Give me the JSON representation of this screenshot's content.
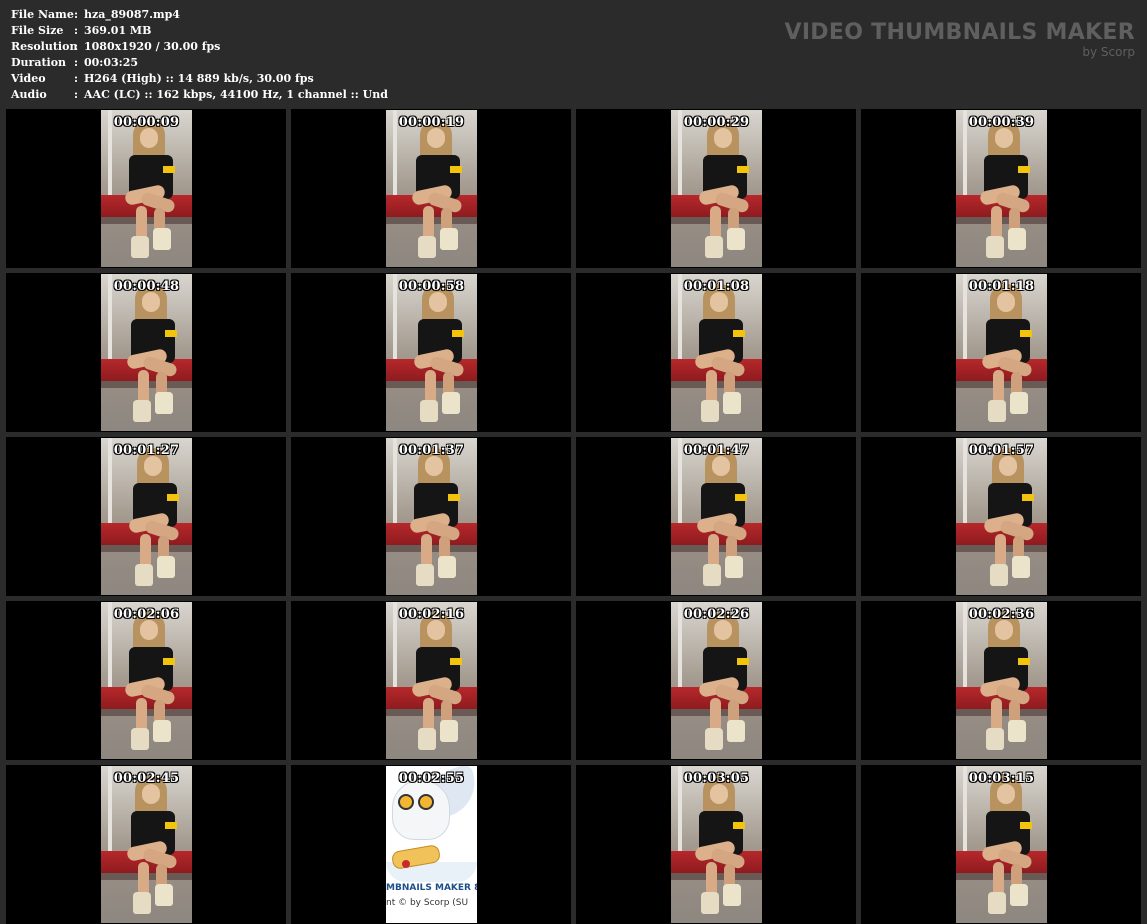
{
  "info": {
    "rows": [
      {
        "label": "File Name",
        "sep": ":",
        "value": "hza_89087.mp4"
      },
      {
        "label": "File Size",
        "sep": ":",
        "value": "369.01 MB"
      },
      {
        "label": "Resolution",
        "sep": ":",
        "value": "1080x1920 / 30.00 fps"
      },
      {
        "label": "Duration",
        "sep": ":",
        "value": "00:03:25"
      },
      {
        "label": "Video",
        "sep": ":",
        "value": "H264 (High) :: 14 889 kb/s, 30.00 fps"
      },
      {
        "label": "Audio",
        "sep": ":",
        "value": "AAC (LC) :: 162 kbps, 44100 Hz, 1 channel :: Und"
      }
    ]
  },
  "brand": {
    "title": "VIDEO THUMBNAILS MAKER",
    "subtitle": "by Scorp"
  },
  "thumbnails": [
    {
      "timestamp": "00:00:09"
    },
    {
      "timestamp": "00:00:19"
    },
    {
      "timestamp": "00:00:29"
    },
    {
      "timestamp": "00:00:39"
    },
    {
      "timestamp": "00:00:48"
    },
    {
      "timestamp": "00:00:58"
    },
    {
      "timestamp": "00:01:08"
    },
    {
      "timestamp": "00:01:18"
    },
    {
      "timestamp": "00:01:27"
    },
    {
      "timestamp": "00:01:37"
    },
    {
      "timestamp": "00:01:47"
    },
    {
      "timestamp": "00:01:57"
    },
    {
      "timestamp": "00:02:06"
    },
    {
      "timestamp": "00:02:16"
    },
    {
      "timestamp": "00:02:26"
    },
    {
      "timestamp": "00:02:36"
    },
    {
      "timestamp": "00:02:45"
    },
    {
      "timestamp": "00:02:55"
    },
    {
      "timestamp": "00:03:05"
    },
    {
      "timestamp": "00:03:15"
    }
  ],
  "splash": {
    "line1": "MBNAILS MAKER 8",
    "line2": "nt © by Scorp (SU"
  },
  "colors": {
    "background": "#2b2b2b",
    "cell": "#000000",
    "seat": "#b7282b",
    "shirt_stripe": "#f2c40e"
  }
}
